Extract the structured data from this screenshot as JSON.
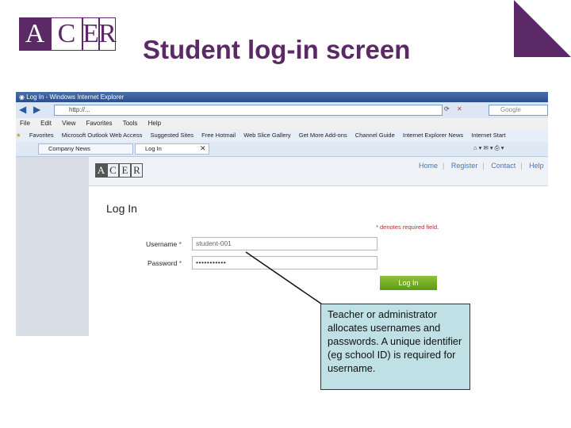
{
  "slide": {
    "logo_letters": [
      "A",
      "C",
      "E",
      "R"
    ],
    "title": "Student log-in screen",
    "accent_color": "#5b2a66"
  },
  "browser": {
    "window_title": "Log In - Windows Internet Explorer",
    "address": "http://...",
    "search_provider": "Google",
    "menu": [
      "File",
      "Edit",
      "View",
      "Favorites",
      "Tools",
      "Help"
    ],
    "favorites_label": "Favorites",
    "favorites": [
      "Microsoft Outlook Web Access",
      "Suggested Sites",
      "Free Hotmail",
      "Web Slice Gallery",
      "Get More Add-ons",
      "Channel Guide",
      "Internet Explorer News",
      "Internet Start"
    ],
    "tabs": [
      "Company News",
      "Log In"
    ]
  },
  "site": {
    "logo_letters": [
      "A",
      "C",
      "E",
      "R"
    ],
    "nav": [
      "Home",
      "Register",
      "Contact",
      "Help"
    ],
    "heading": "Log In",
    "required_note": "* denotes required field.",
    "username_label": "Username",
    "password_label": "Password",
    "required_mark": "*",
    "username_value": "student-001",
    "password_value": "•••••••••••",
    "login_button": "Log In",
    "button_color": "#6aa51f"
  },
  "callout": {
    "text": "Teacher or administrator allocates usernames and passwords. A unique identifier (eg school ID) is required for username."
  }
}
